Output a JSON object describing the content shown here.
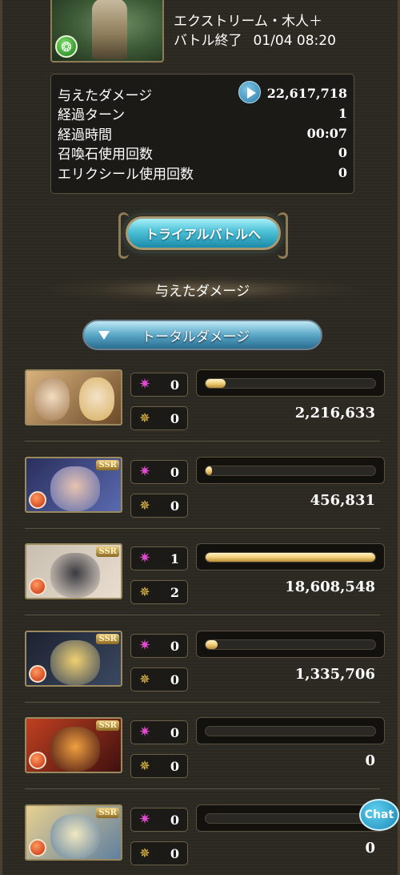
{
  "quest": {
    "name": "エクストリーム・木人＋",
    "status": "バトル終了",
    "datetime": "01/04 08:20",
    "element_icon": "wind-element-icon"
  },
  "stats": [
    {
      "label": "与えたダメージ",
      "value": "22,617,718"
    },
    {
      "label": "経過ターン",
      "value": "1"
    },
    {
      "label": "経過時間",
      "value": "00:07"
    },
    {
      "label": "召喚石使用回数",
      "value": "0"
    },
    {
      "label": "エリクシール使用回数",
      "value": "0"
    }
  ],
  "trial_button_label": "トライアルバトルへ",
  "section_title": "与えたダメージ",
  "dropdown_label": "トータルダメージ",
  "members": [
    {
      "ca_count": "0",
      "skill_count": "0",
      "damage": "2,216,633",
      "bar_fraction": 0.119,
      "portrait": "dual"
    },
    {
      "ca_count": "0",
      "skill_count": "0",
      "damage": "456,831",
      "bar_fraction": 0.025,
      "portrait": "ssr"
    },
    {
      "ca_count": "1",
      "skill_count": "2",
      "damage": "18,608,548",
      "bar_fraction": 1.0,
      "portrait": "ssr"
    },
    {
      "ca_count": "0",
      "skill_count": "0",
      "damage": "1,335,706",
      "bar_fraction": 0.072,
      "portrait": "ssr"
    },
    {
      "ca_count": "0",
      "skill_count": "0",
      "damage": "0",
      "bar_fraction": 0,
      "portrait": "ssr"
    },
    {
      "ca_count": "0",
      "skill_count": "0",
      "damage": "0",
      "bar_fraction": 0,
      "portrait": "ssr"
    }
  ],
  "ssr_badge": "SSR",
  "chat_label": "Chat",
  "colors": {
    "background": "#2c2922",
    "bar_fill": "#f0cf7a",
    "button_cyan": "#4bc0d6",
    "ca_icon": "#e04ad0"
  }
}
